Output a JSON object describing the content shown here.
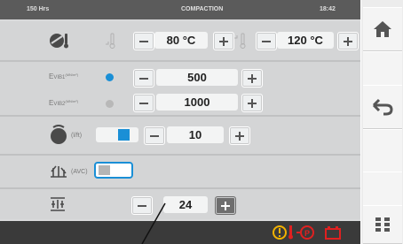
{
  "header": {
    "hours": "150 Hrs",
    "title": "COMPACTION",
    "time": "18:42"
  },
  "temperature": {
    "min_value": "80 °C",
    "max_value": "120 °C"
  },
  "evib": {
    "evib1_label": "E",
    "evib1_sub": "VIB1",
    "evib1_unit": "(MN/m²)",
    "evib1_value": "500",
    "evib2_label": "E",
    "evib2_sub": "VIB2",
    "evib2_unit": "(MN/m²)",
    "evib2_value": "1000"
  },
  "drum": {
    "unit": "(l/ft)",
    "value": "10"
  },
  "avc": {
    "label": "(AVC)"
  },
  "passes": {
    "value": "24"
  },
  "sidebar": {
    "home_icon": "home-icon",
    "back_icon": "back-arrow-icon",
    "menu_icon": "grid-menu-icon"
  },
  "status": {
    "icons": [
      "engine-warning-icon",
      "parking-brake-icon",
      "battery-icon"
    ]
  },
  "colors": {
    "accent": "#1a8fd6",
    "warning": "#f2b200",
    "alert": "#e02020",
    "bar": "#3a3a3a"
  }
}
